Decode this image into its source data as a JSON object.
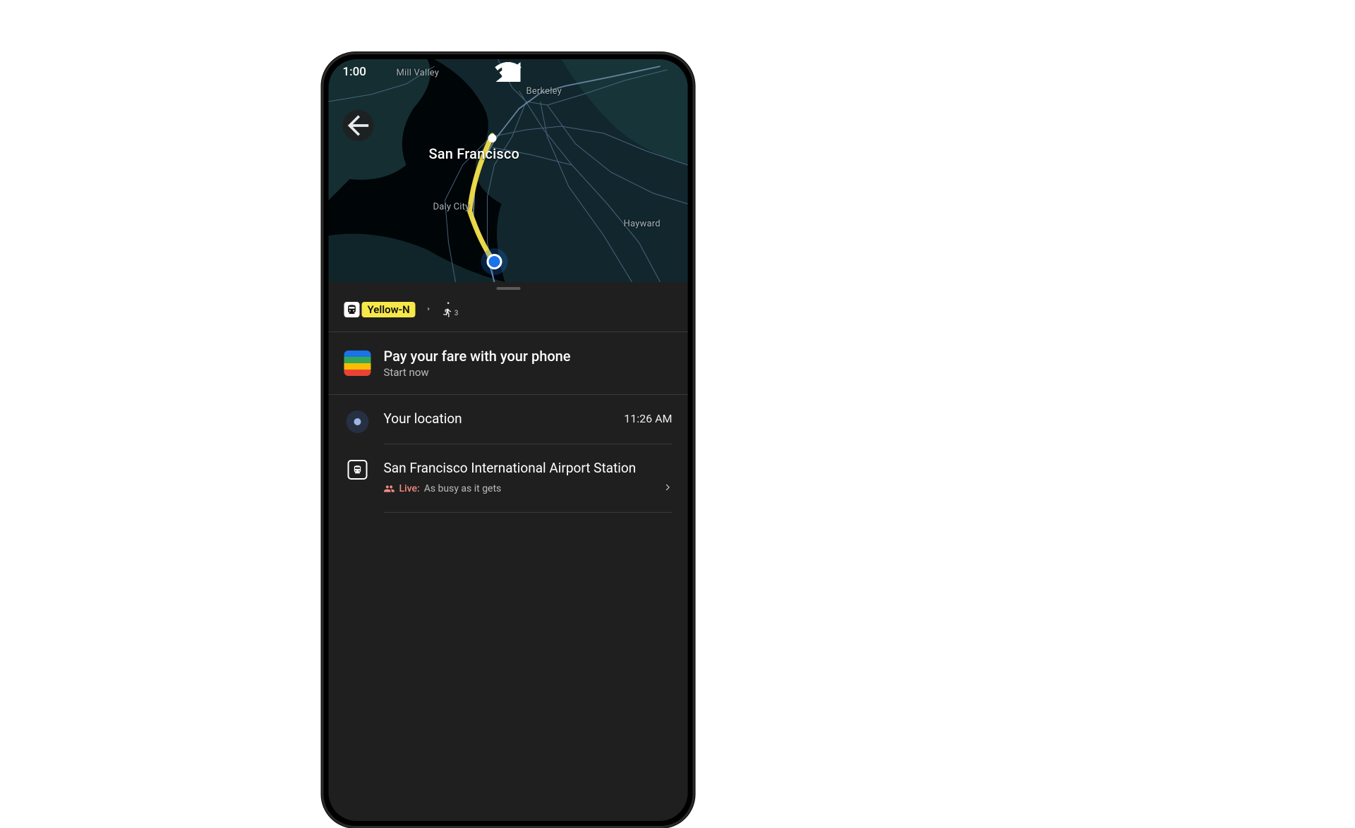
{
  "status": {
    "time": "1:00"
  },
  "map": {
    "destination_label": "San Francisco",
    "labels": {
      "mill_valley": "Mill Valley",
      "berkeley": "Berkeley",
      "daly_city": "Daly City",
      "hayward": "Hayward"
    }
  },
  "route": {
    "transit_line": "Yellow-N",
    "walk_minutes": "3"
  },
  "fare_card": {
    "title": "Pay your fare with your phone",
    "subtitle": "Start now"
  },
  "step_location": {
    "title": "Your location",
    "time": "11:26 AM"
  },
  "step_station": {
    "title": "San Francisco International Airport Station",
    "live_label": "Live:",
    "live_text": "As busy as it gets"
  }
}
